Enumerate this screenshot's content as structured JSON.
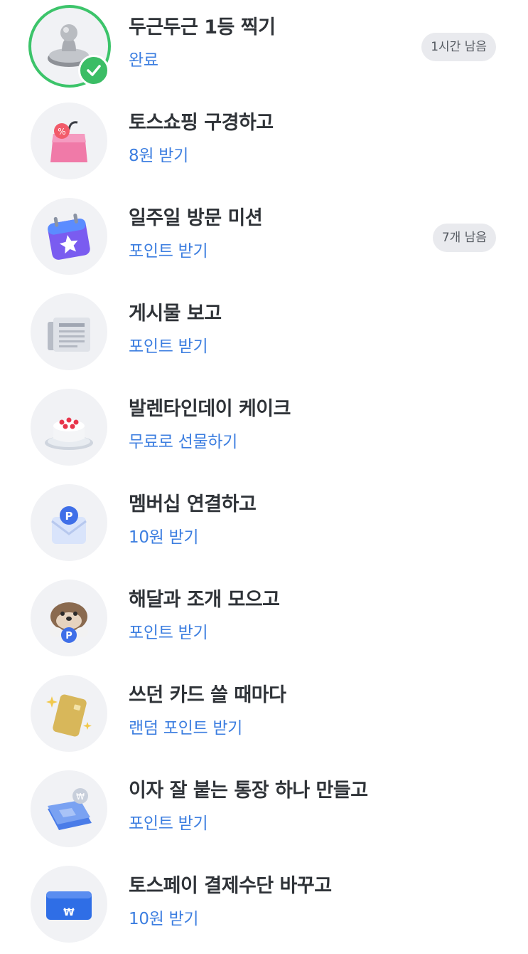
{
  "missions": [
    {
      "title": "두근두근 1등 찍기",
      "reward": "완료",
      "badge": "1시간 남음",
      "icon": "stamp-icon",
      "status": "completed"
    },
    {
      "title": "토스쇼핑 구경하고",
      "reward": "8원 받기",
      "icon": "shopping-bag-icon"
    },
    {
      "title": "일주일 방문 미션",
      "reward": "포인트 받기",
      "badge": "7개 남음",
      "icon": "calendar-star-icon"
    },
    {
      "title": "게시물 보고",
      "reward": "포인트 받기",
      "icon": "newspaper-icon"
    },
    {
      "title": "발렌타인데이 케이크",
      "reward": "무료로 선물하기",
      "icon": "cake-icon"
    },
    {
      "title": "멤버십 연결하고",
      "reward": "10원 받기",
      "icon": "membership-envelope-icon"
    },
    {
      "title": "해달과 조개 모으고",
      "reward": "포인트 받기",
      "icon": "otter-icon"
    },
    {
      "title": "쓰던 카드 쓸 때마다",
      "reward": "랜덤 포인트 받기",
      "icon": "gold-card-icon"
    },
    {
      "title": "이자 잘 붙는 통장 하나 만들고",
      "reward": "포인트 받기",
      "icon": "bankbook-icon"
    },
    {
      "title": "토스페이 결제수단 바꾸고",
      "reward": "10원 받기",
      "icon": "payment-card-icon"
    }
  ],
  "colors": {
    "title": "#2f3338",
    "reward": "#3c7ee0",
    "complete_ring": "#3cc46a",
    "badge_bg": "#e9eaee"
  }
}
